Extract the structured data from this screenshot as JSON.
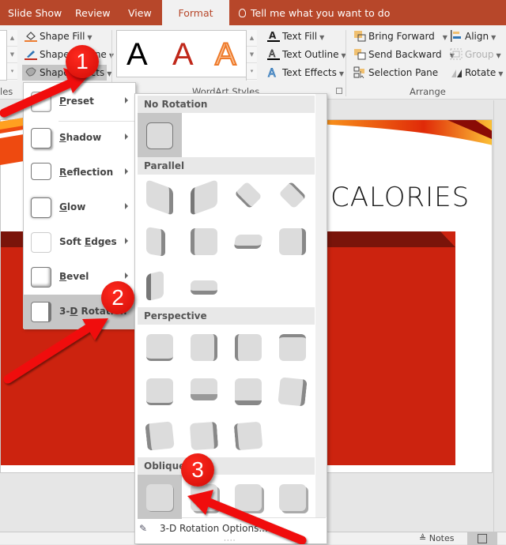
{
  "tabs": [
    {
      "label": "Slide Show",
      "active": false
    },
    {
      "label": "Review",
      "active": false
    },
    {
      "label": "View",
      "active": false
    },
    {
      "label": "Format",
      "active": true
    }
  ],
  "tell_me": "Tell me what you want to do",
  "ribbon": {
    "shape_styles": {
      "shape_fill": "Shape Fill",
      "shape_outline": "Shape Outline",
      "shape_effects": "Shape Effects",
      "group_label_partial": "les"
    },
    "wordart": {
      "samples": [
        "A",
        "A",
        "A"
      ],
      "group_label": "WordArt Styles",
      "text_fill": "Text Fill",
      "text_outline": "Text Outline",
      "text_effects": "Text Effects"
    },
    "arrange": {
      "bring_forward": "Bring Forward",
      "send_backward": "Send Backward",
      "selection_pane": "Selection Pane",
      "align": "Align",
      "group": "Group",
      "rotate": "Rotate",
      "group_label": "Arrange"
    }
  },
  "slide": {
    "title_fragment": "CALORIES"
  },
  "shape_effects_menu": [
    {
      "label": "Preset",
      "underline": "P"
    },
    {
      "label": "Shadow",
      "underline": "S"
    },
    {
      "label": "Reflection",
      "underline": "R"
    },
    {
      "label": "Glow",
      "underline": "G"
    },
    {
      "label": "Soft Edges",
      "underline": "E"
    },
    {
      "label": "Bevel",
      "underline": "B"
    },
    {
      "label": "3-D Rotation",
      "underline": "D",
      "highlighted": true
    }
  ],
  "rotation_gallery": {
    "sections": [
      {
        "title": "No Rotation",
        "count": 1
      },
      {
        "title": "Parallel",
        "count": 10
      },
      {
        "title": "Perspective",
        "count": 11
      },
      {
        "title": "Oblique",
        "count": 4
      }
    ],
    "options_label": "3-D Rotation Options..."
  },
  "status_bar": {
    "notes": "Notes"
  },
  "annotations": [
    "1",
    "2",
    "3"
  ],
  "colors": {
    "accent": "#b7472a",
    "annotation_red": "#e8120c",
    "slide_red": "#cc230f"
  }
}
